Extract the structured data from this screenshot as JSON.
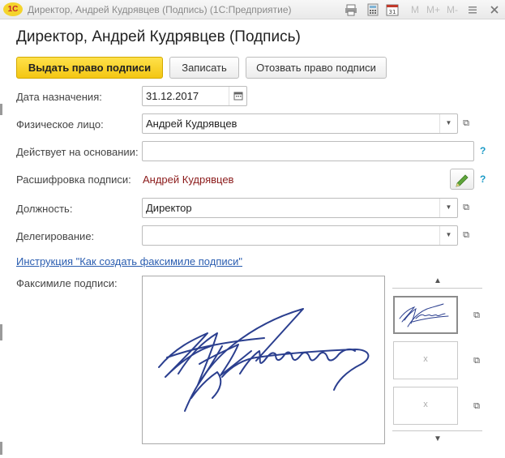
{
  "window": {
    "logo_text": "1С",
    "title": "Директор, Андрей Кудрявцев (Подпись)  (1С:Предприятие)",
    "toolbar": {
      "m": "M",
      "m_plus": "M+",
      "m_minus": "M-"
    }
  },
  "page": {
    "title": "Директор, Андрей Кудрявцев (Подпись)"
  },
  "actions": {
    "grant": "Выдать право подписи",
    "save": "Записать",
    "revoke": "Отозвать право подписи"
  },
  "form": {
    "date": {
      "label": "Дата назначения:",
      "value": "31.12.2017"
    },
    "person": {
      "label": "Физическое лицо:",
      "value": "Андрей Кудрявцев"
    },
    "basis": {
      "label": "Действует на основании:",
      "value": ""
    },
    "decoding": {
      "label": "Расшифровка подписи:",
      "value": "Андрей Кудрявцев"
    },
    "position": {
      "label": "Должность:",
      "value": "Директор"
    },
    "delegation": {
      "label": "Делегирование:",
      "value": ""
    },
    "help_mark": "?"
  },
  "instruction_link": "Инструкция \"Как создать факсимиле подписи\"",
  "facsimile": {
    "label": "Факсимиле подписи:",
    "empty_marks": [
      "x",
      "x"
    ]
  },
  "colors": {
    "primary_button": "#f3c613",
    "link": "#2a5db0",
    "decoding_text": "#8b1a1a",
    "help": "#1a9ac6",
    "signature_ink": "#2b3f8f"
  }
}
